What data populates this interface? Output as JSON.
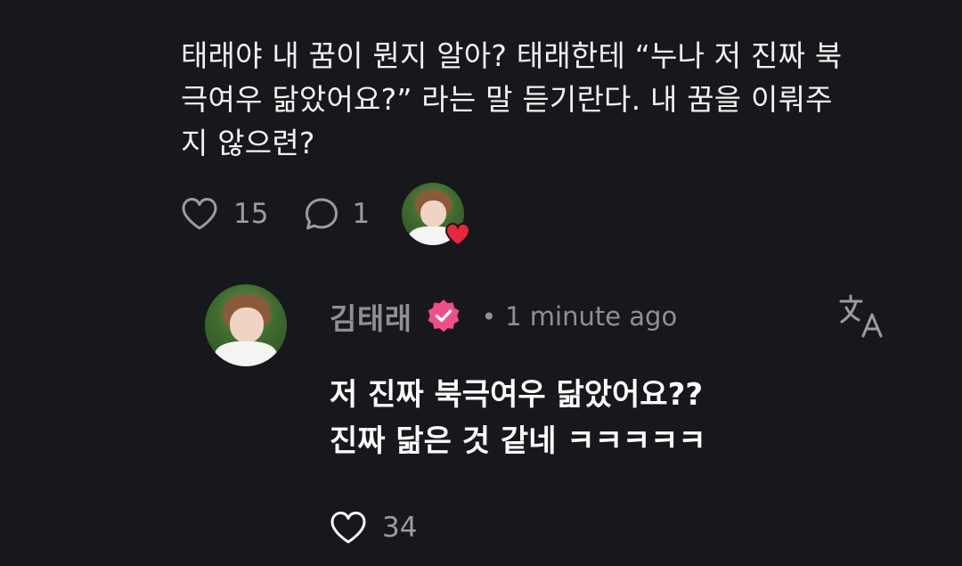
{
  "post": {
    "lines": [
      "태래야 내 꿈이 뭔지 알아? 태래한테 “누나 저 진짜 북",
      "극여우 닮았어요?” 라는 말 듣기란다. 내 꿈을 이뤄주",
      "지 않으련?"
    ],
    "like_count": "15",
    "comment_count": "1",
    "like_icon": "heart-outline-icon",
    "comment_icon": "speech-bubble-icon",
    "liked_badge_icon": "red-heart-icon"
  },
  "reply": {
    "author": "김태래",
    "verified_icon": "verified-badge-icon",
    "separator": "•",
    "time": "1 minute ago",
    "translate_icon": "translate-icon",
    "lines": [
      "저 진짜 북극여우 닮았어요??",
      "진짜 닮은 것 같네 ㅋㅋㅋㅋㅋ"
    ],
    "like_count": "34"
  },
  "colors": {
    "background": "#16181b",
    "text_primary": "#ffffff",
    "text_secondary": "#9a9ca0",
    "verified_badge": "#f04e87",
    "heart_red": "#e8283a"
  }
}
